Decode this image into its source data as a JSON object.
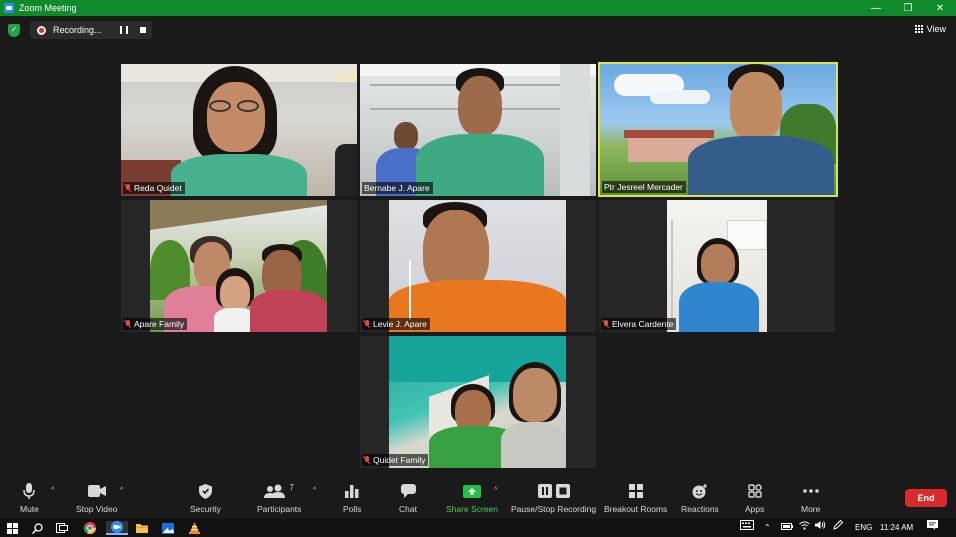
{
  "window": {
    "title": "Zoom Meeting",
    "minimize": "—",
    "restore": "❐",
    "close": "✕"
  },
  "topbar": {
    "recording_label": "Recording...",
    "view_label": "View"
  },
  "participants": [
    {
      "name": "Reda Quidet",
      "muted": true
    },
    {
      "name": "Bernabe J. Apare",
      "muted": false
    },
    {
      "name": "Ptr Jesreel Mercader",
      "muted": false,
      "active_speaker": true
    },
    {
      "name": "Apare Family",
      "muted": true
    },
    {
      "name": "Levie J. Apare",
      "muted": true
    },
    {
      "name": "Elvera Cardente",
      "muted": true
    },
    {
      "name": "Quidet Family",
      "muted": true
    }
  ],
  "toolbar": {
    "mute": "Mute",
    "stop_video": "Stop Video",
    "security": "Security",
    "participants": "Participants",
    "participants_count": "7",
    "polls": "Polls",
    "chat": "Chat",
    "share_screen": "Share Screen",
    "pause_stop_recording": "Pause/Stop Recording",
    "breakout_rooms": "Breakout Rooms",
    "reactions": "Reactions",
    "apps": "Apps",
    "more": "More",
    "end": "End"
  },
  "colors": {
    "accent_green": "#118a2b",
    "active_speaker": "#d9e34a",
    "end_red": "#d92b2b",
    "share_green": "#23c244"
  },
  "taskbar": {
    "language": "ENG",
    "time": "11:24 AM"
  }
}
